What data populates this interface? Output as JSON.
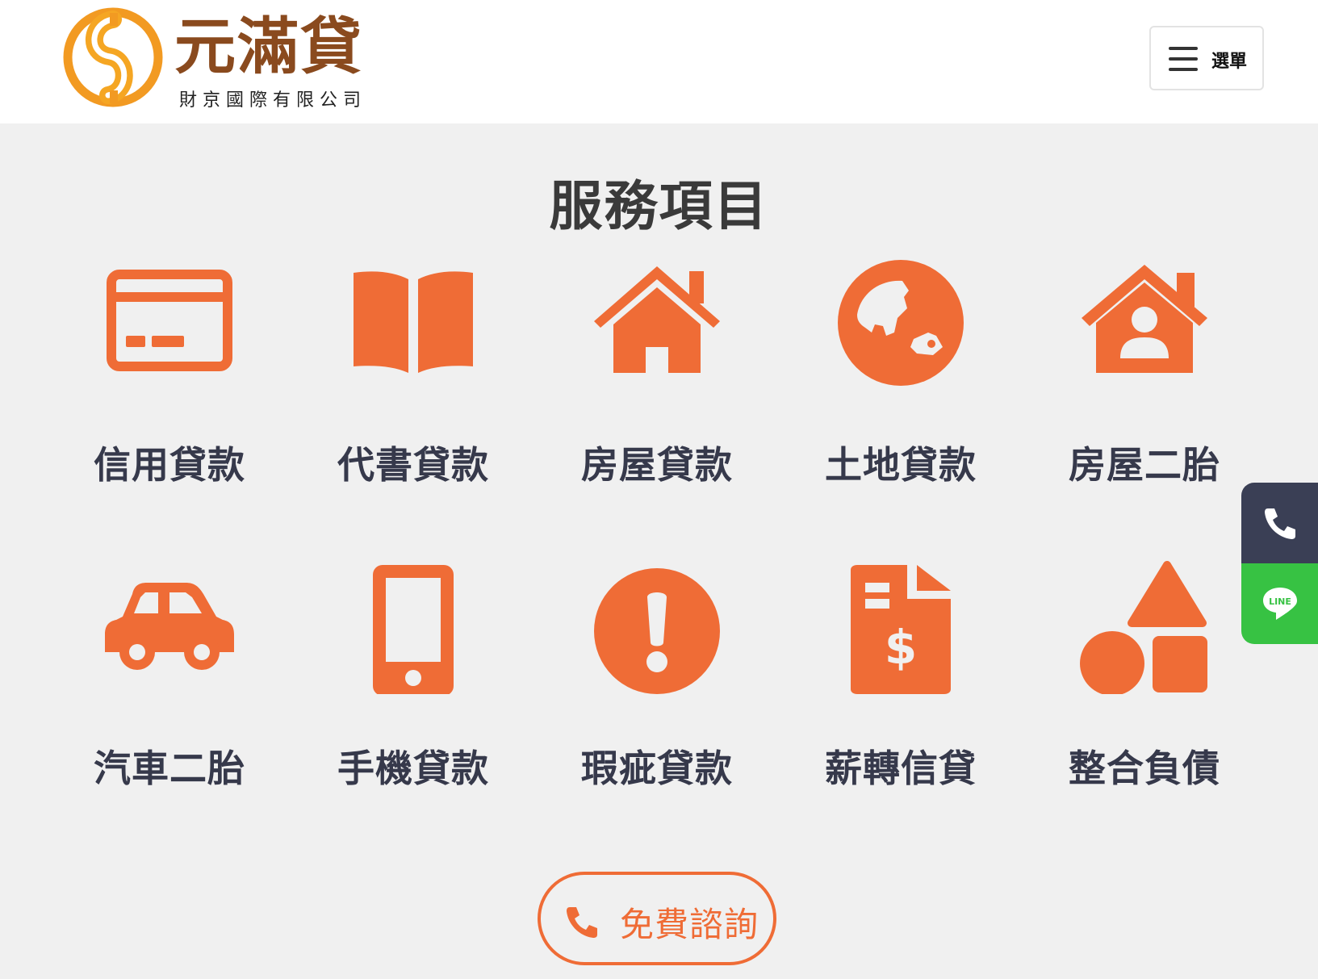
{
  "brand": {
    "name": "元滿貸",
    "subtitle": "財京國際有限公司"
  },
  "header": {
    "menu_label": "選單"
  },
  "section": {
    "title": "服務項目"
  },
  "services": [
    {
      "label": "信用貸款",
      "icon": "credit-card-icon"
    },
    {
      "label": "代書貸款",
      "icon": "book-open-icon"
    },
    {
      "label": "房屋貸款",
      "icon": "house-icon"
    },
    {
      "label": "土地貸款",
      "icon": "globe-icon"
    },
    {
      "label": "房屋二胎",
      "icon": "house-user-icon"
    },
    {
      "label": "汽車二胎",
      "icon": "car-icon"
    },
    {
      "label": "手機貸款",
      "icon": "mobile-phone-icon"
    },
    {
      "label": "瑕疵貸款",
      "icon": "exclamation-circle-icon"
    },
    {
      "label": "薪轉信貸",
      "icon": "invoice-dollar-icon"
    },
    {
      "label": "整合負債",
      "icon": "shapes-icon"
    }
  ],
  "side_buttons": {
    "line_text": "LINE"
  },
  "cta": {
    "label": "免費諮詢"
  },
  "colors": {
    "accent": "#ef6c36",
    "text_dark": "#36394b",
    "header_bg": "#ffffff",
    "page_bg": "#f0f0f0",
    "phone_bg": "#3a3f55",
    "line_bg": "#37c243",
    "logo_text": "#8a4a1e"
  }
}
